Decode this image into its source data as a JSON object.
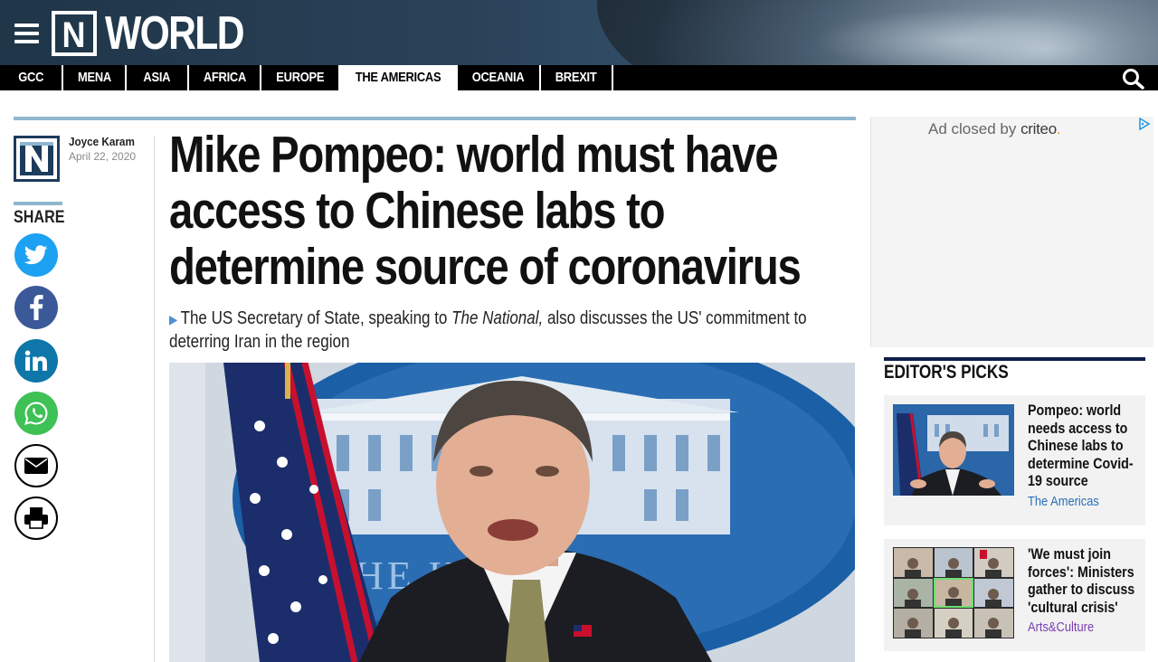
{
  "brand": {
    "logo_text": "WORLD",
    "logo_mark": "N"
  },
  "nav": {
    "items": [
      {
        "label": "GCC",
        "active": false
      },
      {
        "label": "MENA",
        "active": false
      },
      {
        "label": "ASIA",
        "active": false
      },
      {
        "label": "AFRICA",
        "active": false
      },
      {
        "label": "EUROPE",
        "active": false
      },
      {
        "label": "THE AMERICAS",
        "active": true
      },
      {
        "label": "OCEANIA",
        "active": false
      },
      {
        "label": "BREXIT",
        "active": false
      }
    ],
    "search_icon": "search-icon",
    "menu_icon": "hamburger-menu-icon"
  },
  "article": {
    "author": "Joyce Karam",
    "date": "April 22, 2020",
    "headline": "Mike Pompeo: world must have access to Chinese labs to determine source of coronavirus",
    "standfirst_pre": "The US Secretary of State, speaking to ",
    "standfirst_italic": "The National,",
    "standfirst_post": " also discusses the US' commitment to deterring Iran in the region",
    "hero_sign_text": "HE       HOUSE"
  },
  "share": {
    "label": "SHARE",
    "buttons": [
      "twitter-icon",
      "facebook-icon",
      "linkedin-icon",
      "whatsapp-icon",
      "email-icon",
      "print-icon"
    ]
  },
  "ad": {
    "closed_text": "Ad closed by",
    "brand": "criteo",
    "brand_dot": "."
  },
  "editors_picks": {
    "title": "EDITOR'S PICKS",
    "items": [
      {
        "headline": "Pompeo: world needs access to Chinese labs to determine Covid-19 source",
        "category": "The Americas"
      },
      {
        "headline": "'We must join forces': Ministers gather to discuss 'cultural crisis'",
        "category": "Arts&Culture"
      }
    ]
  },
  "colors": {
    "accent_rule": "#8fb7cf",
    "nav_bg": "#000000",
    "twitter": "#1da1f2",
    "facebook": "#3b5998",
    "linkedin": "#0e76a8",
    "whatsapp": "#3ec155",
    "category_americas": "#2a6fb5",
    "category_arts": "#7a3fb0"
  }
}
